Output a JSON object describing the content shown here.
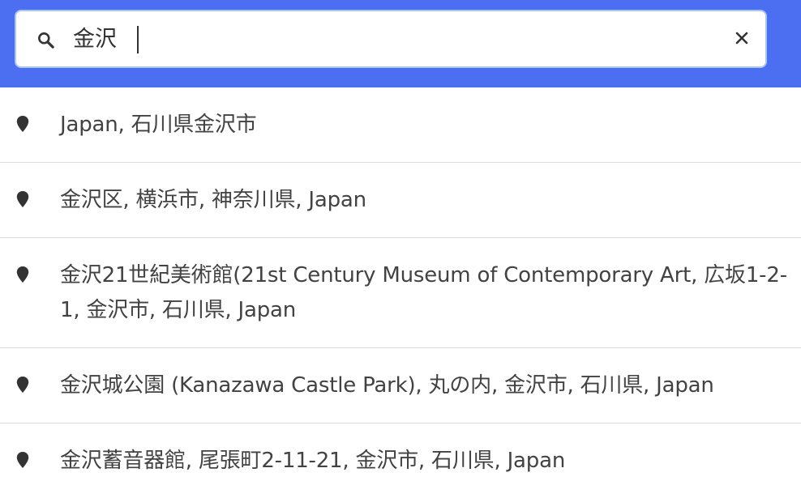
{
  "search": {
    "value": "金沢",
    "icon": "search-icon",
    "clear_icon": "close-icon"
  },
  "results": [
    {
      "label": "Japan, 石川県金沢市",
      "icon": "map-pin-icon"
    },
    {
      "label": "金沢区, 横浜市, 神奈川県, Japan",
      "icon": "map-pin-icon"
    },
    {
      "label": "金沢21世紀美術館(21st Century Museum of Contemporary Art, 広坂1-2-1, 金沢市, 石川県, Japan",
      "icon": "map-pin-icon"
    },
    {
      "label": "金沢城公園 (Kanazawa Castle Park), 丸の内, 金沢市, 石川県, Japan",
      "icon": "map-pin-icon"
    },
    {
      "label": "金沢蓄音器館, 尾張町2-11-21, 金沢市, 石川県, Japan",
      "icon": "map-pin-icon"
    }
  ],
  "colors": {
    "header_bg": "#4c6ef0",
    "search_border": "#a9c7f2",
    "text": "#424242",
    "divider": "#dcdcdc"
  }
}
